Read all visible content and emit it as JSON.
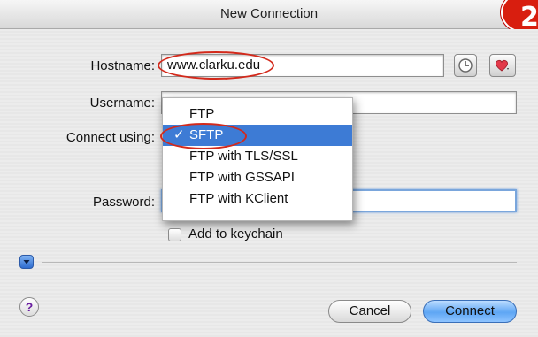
{
  "window": {
    "title": "New Connection",
    "step_badge": "2"
  },
  "form": {
    "hostname_label": "Hostname:",
    "hostname_value": "www.clarku.edu",
    "username_label": "Username:",
    "username_value": "",
    "connect_using_label": "Connect using:",
    "password_label": "Password:",
    "password_value": "",
    "keychain_label": "Add to keychain",
    "keychain_checked": false
  },
  "protocol_menu": {
    "selected": "SFTP",
    "check_glyph": "✓",
    "options": [
      "FTP",
      "SFTP",
      "FTP with TLS/SSL",
      "FTP with GSSAPI",
      "FTP with KClient"
    ]
  },
  "icons": {
    "history": "clock-icon",
    "favorites": "heart-icon",
    "disclosure": "disclosure-triangle-icon",
    "help": "help-icon"
  },
  "footer": {
    "help_glyph": "?",
    "cancel_label": "Cancel",
    "connect_label": "Connect"
  },
  "colors": {
    "accent": "#3d7bd5",
    "annotation": "#d3291b"
  }
}
